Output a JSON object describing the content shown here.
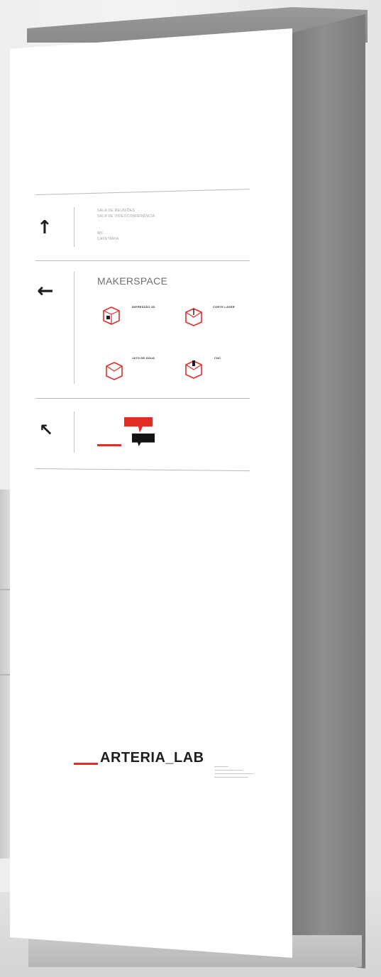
{
  "sign": {
    "section_1": {
      "arrow": "↑",
      "lines": [
        "SALA DE REUNIÕES",
        "SALA DE VIDEOCONFERÊNCIA",
        "WC",
        "CAFETARIA"
      ]
    },
    "section_2": {
      "arrow": "←",
      "heading": "MAKERSPACE",
      "items": [
        {
          "label": "IMPRESSÃO 3D",
          "icon": "cube-3d-icon"
        },
        {
          "label": "CORTE LASER",
          "icon": "cube-laser-icon"
        },
        {
          "label": "JATO DE ÁGUA",
          "icon": "cube-water-icon"
        },
        {
          "label": "CNC",
          "icon": "cube-cnc-icon"
        }
      ]
    },
    "section_3": {
      "arrow": "↖"
    },
    "brand": {
      "name": "ARTERIA_LAB"
    }
  },
  "colors": {
    "accent_red": "#e42c27",
    "ink": "#1d1d1d",
    "panel": "#ffffff",
    "totem_side": "#8a8a8a"
  }
}
